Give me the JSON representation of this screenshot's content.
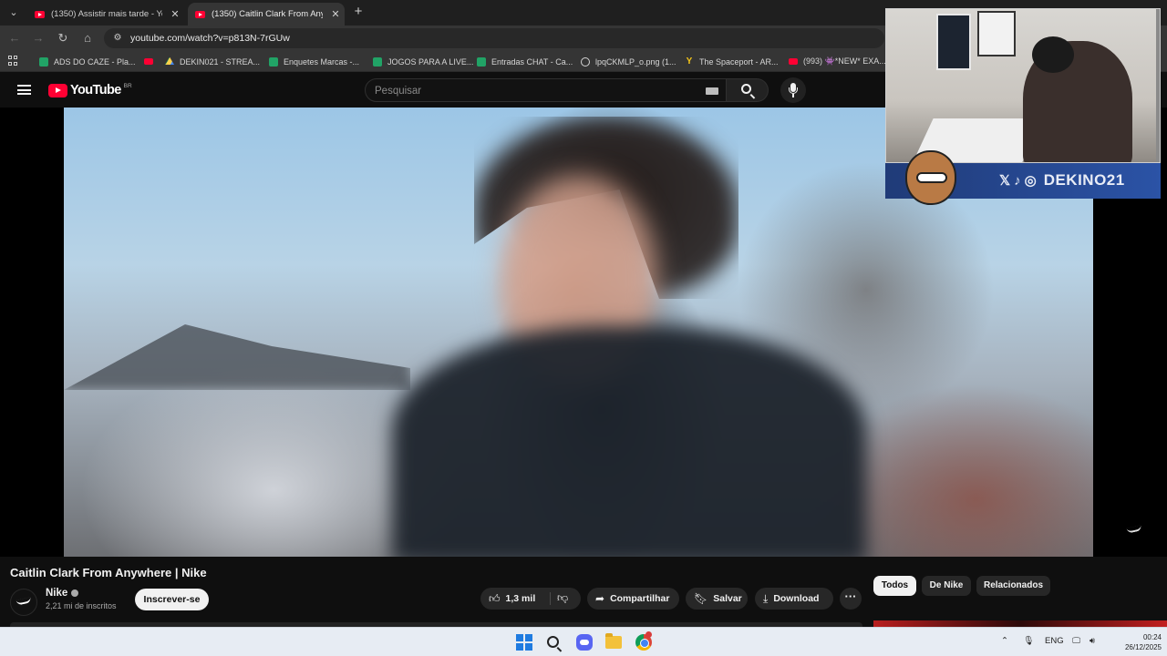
{
  "browser": {
    "tabs": [
      {
        "label": "(1350) Assistir mais tarde - You",
        "active": false
      },
      {
        "label": "(1350) Caitlin Clark From Anyw",
        "active": true
      }
    ],
    "url": "youtube.com/watch?v=p813N-7rGUw",
    "bookmarks": [
      {
        "label": "ADS DO CAZE - Pla...",
        "icon": "sheets-icon"
      },
      {
        "label": "",
        "icon": "youtube-icon"
      },
      {
        "label": "DEKIN021 - STREA...",
        "icon": "drive-icon"
      },
      {
        "label": "Enquetes Marcas -...",
        "icon": "sheets-icon"
      },
      {
        "label": "JOGOS PARA A LIVE...",
        "icon": "sheets-icon"
      },
      {
        "label": "Entradas CHAT - Ca...",
        "icon": "sheets-icon"
      },
      {
        "label": "lpqCKMLP_o.png (1...",
        "icon": "lens-icon"
      },
      {
        "label": "The Spaceport - AR...",
        "icon": "y-icon"
      },
      {
        "label": "(993) 👾*NEW* EXA...",
        "icon": "youtube-icon"
      }
    ]
  },
  "youtube": {
    "logo_text": "YouTube",
    "country_code": "BR",
    "search_placeholder": "Pesquisar"
  },
  "overlay": {
    "handle": "DEKINO21"
  },
  "video": {
    "title": "Caitlin Clark From Anywhere | Nike",
    "channel": "Nike",
    "subscribers": "2,21 mi de inscritos",
    "subscribe_label": "Inscrever-se",
    "likes": "1,3 mil",
    "share_label": "Compartilhar",
    "save_label": "Salvar",
    "download_label": "Download",
    "chips": [
      "Todos",
      "De Nike",
      "Relacionados"
    ]
  },
  "taskbar": {
    "language": "ENG",
    "time": "00:24",
    "date": "26/12/2025"
  }
}
